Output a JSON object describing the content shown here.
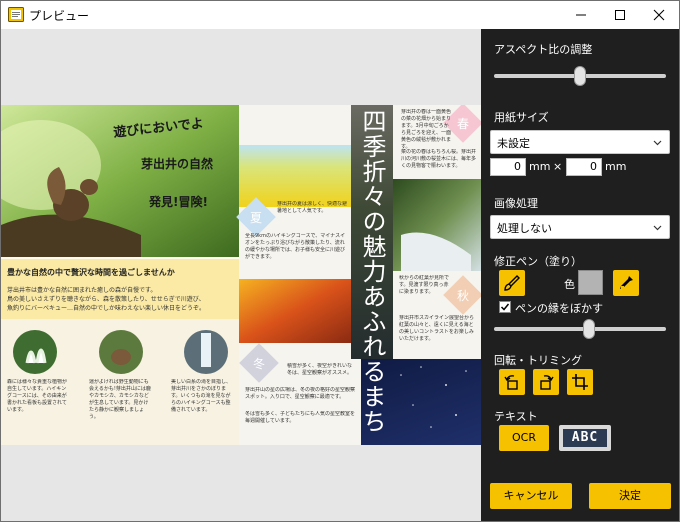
{
  "window": {
    "title": "プレビュー"
  },
  "page": {
    "headline": "四季折々の魅力あふれるまち",
    "handwritten": [
      "遊びにおいでよ",
      "芽出井の自然",
      "発見!冒険!"
    ],
    "banner": "豊かな自然の中で贅沢な時間を過ごしませんか",
    "intro": [
      "芽出井市は豊かな自然に囲まれた癒しの森が自慢です。",
      "鳥の美しいさえずりを聴きながら、森を散策したり、せせらぎで川遊び、",
      "魚釣りにバーベキュー…自然の中でしか味わえない楽しい休日をどうぞ。"
    ],
    "cards": [
      "森には様々な貴重な植物が自生しています。ハイキングコースには、その由来が書かれた看板も設置されています。",
      "運がよければ野生動物にも会えるかも!芽出井山には鹿やカモシカ、カモシカなどが生息しています。見かけたら静かに観察しましょう。",
      "美しい白糸の滝を目指し、芽出井川をさかのぼります。いくつもの滝を見ながらのハイキングコースも整備されています。"
    ],
    "seasons": [
      {
        "char": "春",
        "text": [
          "芽出井の春は一面黄色の菜の花畑から始まります。3月中旬ごろから見ごろを迎え、一面黄色の絨毯が敷かれます。",
          "菜の花の春はもちろん桜。芽出井川の河川敷の桜並木には、毎年多くの見物客で賑わいます。"
        ]
      },
      {
        "char": "夏",
        "text": [
          "芽出井の夏は涼しく、快適な避暑地として人気です。",
          "全長9kmのハイキングコースで、マイナスイオンをたっぷり浴びながら散策したり、流れの緩やかな場所では、お子様も安全に川遊びができます。"
        ]
      },
      {
        "char": "秋",
        "text": [
          "秋からの紅葉が見所です。見渡す限り真っ赤に染まります。",
          "芽出井市スカイライン展望台から紅葉の山々と、遠くに見える海との美しいコントラストをお楽しみいただけます。"
        ]
      },
      {
        "char": "冬",
        "text": [
          "積雪が多く、夜空がきれいな冬は、星空観察がオススメ。",
          "芽出井山の星の広場は、冬の夜の格好の星空観察スポット。入り口で、星空観察に最適です。",
          "冬は雪も多く、子どもたちにも人気の星空教室を毎週開催しています。"
        ]
      }
    ]
  },
  "panel": {
    "aspect_label": "アスペクト比の調整",
    "aspect_value": 0.5,
    "paper_label": "用紙サイズ",
    "paper_selected": "未設定",
    "width_value": "0",
    "height_value": "0",
    "unit_mm": "mm",
    "times": "×",
    "processing_label": "画像処理",
    "processing_selected": "処理しない",
    "pen_label": "修正ペン（塗り）",
    "color_label": "色",
    "pen_color": "#b4b3b3",
    "blur_label": "ペンの縁をぼかす",
    "blur_checked": true,
    "blur_value": 0.55,
    "rotate_label": "回転・トリミング",
    "text_label": "テキスト",
    "ocr_label": "OCR",
    "abc_label": "ABC",
    "cancel_label": "キャンセル",
    "ok_label": "決定",
    "accent": "#f6c200"
  }
}
